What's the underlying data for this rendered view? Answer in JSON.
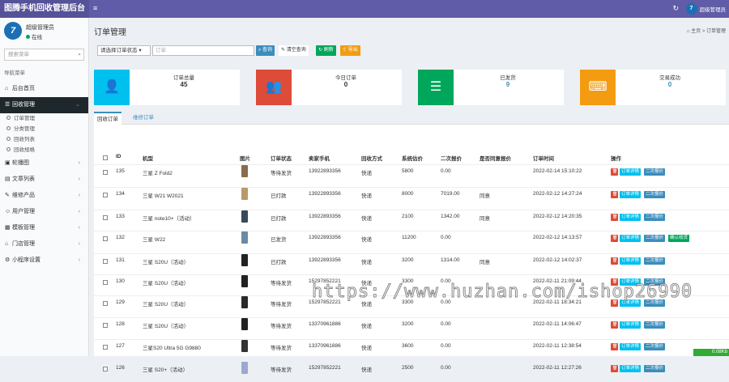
{
  "header": {
    "app_title": "图腾手机回收管理后台",
    "menu_icon": "≡",
    "refresh_icon": "↻",
    "user_name": "超级管理员",
    "avatar_glyph": "7"
  },
  "sidebar": {
    "user_name": "超级管理员",
    "status": "在线",
    "search_placeholder": "搜索菜单",
    "nav_header": "导航菜单",
    "items": [
      {
        "label": "后台首页",
        "icon": "home-icon",
        "active": false,
        "top": true
      },
      {
        "label": "回收管理",
        "icon": "list-icon",
        "active": true
      },
      {
        "label": "轮播图",
        "icon": "image-icon"
      },
      {
        "label": "文章列表",
        "icon": "doc-icon"
      },
      {
        "label": "维修产品",
        "icon": "wrench-icon"
      },
      {
        "label": "用户管理",
        "icon": "user-icon"
      },
      {
        "label": "模板管理",
        "icon": "template-icon"
      },
      {
        "label": "门店管理",
        "icon": "store-icon"
      },
      {
        "label": "小程序设置",
        "icon": "settings-icon"
      }
    ],
    "subitems": [
      "订单管理",
      "分类管理",
      "回收列表",
      "回收规格"
    ]
  },
  "page": {
    "title": "订单管理",
    "breadcrumb_home": "主页",
    "breadcrumb_current": "订单管理"
  },
  "filter": {
    "status_select": "请选择订单状态",
    "search_placeholder": "订单",
    "btn_search": "查询",
    "btn_clear": "清空查询",
    "btn_refresh": "刷新",
    "btn_export": "导出"
  },
  "stats": [
    {
      "label": "订单总量",
      "value": "45",
      "color": "#00c0ef",
      "icon": "user-icon"
    },
    {
      "label": "今日订单",
      "value": "0",
      "color": "#dd4b39",
      "icon": "users-icon"
    },
    {
      "label": "已发货",
      "value": "9",
      "color": "#00a65a",
      "icon": "list-icon"
    },
    {
      "label": "交易成功",
      "value": "0",
      "color": "#f39c12",
      "icon": "keyboard-icon"
    }
  ],
  "tabs": [
    "回收订单",
    "维修订单"
  ],
  "table": {
    "headers": [
      "ID",
      "机型",
      "图片",
      "订单状态",
      "卖家手机",
      "回收方式",
      "系统估价",
      "二次报价",
      "是否同意报价",
      "订单时间",
      "操作"
    ],
    "actions": {
      "detail": "订单详情",
      "quote": "二次报价",
      "confirm": "确认收货"
    },
    "rows": [
      {
        "id": "135",
        "model": "三星 Z Fold2",
        "status": "等待发货",
        "phone": "13922893356",
        "method": "快递",
        "est": "5800",
        "quote": "0.00",
        "agree": "",
        "time": "2022-02-14 15:10:22",
        "thumb": "#8a6b4e",
        "confirm": false
      },
      {
        "id": "134",
        "model": "三星 W21 W2021",
        "status": "已打款",
        "phone": "13922893356",
        "method": "快递",
        "est": "8000",
        "quote": "7019.00",
        "agree": "同意",
        "time": "2022-02-12 14:27:24",
        "thumb": "#b89a6a",
        "confirm": false
      },
      {
        "id": "133",
        "model": "三星 note10+（活动）",
        "status": "已打款",
        "phone": "13922893356",
        "method": "快递",
        "est": "2100",
        "quote": "1342.00",
        "agree": "同意",
        "time": "2022-02-12 14:20:35",
        "thumb": "#3a4a5a",
        "confirm": false
      },
      {
        "id": "132",
        "model": "三星 W22",
        "status": "已发货",
        "phone": "13922893356",
        "method": "快递",
        "est": "11200",
        "quote": "0.00",
        "agree": "",
        "time": "2022-02-12 14:13:57",
        "thumb": "#6a8aa6",
        "confirm": true
      },
      {
        "id": "131",
        "model": "三星 S20U（活动）",
        "status": "已打款",
        "phone": "13922893356",
        "method": "快递",
        "est": "3200",
        "quote": "1314.00",
        "agree": "同意",
        "time": "2022-02-12 14:02:37",
        "thumb": "#222",
        "confirm": false
      },
      {
        "id": "130",
        "model": "三星 S20U（活动）",
        "status": "等待发货",
        "phone": "15297852221",
        "method": "快递",
        "est": "3300",
        "quote": "0.00",
        "agree": "",
        "time": "2022-02-11 21:09:44",
        "thumb": "#222",
        "confirm": false
      },
      {
        "id": "129",
        "model": "三星 S20U（活动）",
        "status": "等待发货",
        "phone": "15297852221",
        "method": "快递",
        "est": "3300",
        "quote": "0.00",
        "agree": "",
        "time": "2022-02-11 18:34:21",
        "thumb": "#2a2a2a",
        "confirm": false
      },
      {
        "id": "128",
        "model": "三星 S20U（活动）",
        "status": "等待发货",
        "phone": "13370961886",
        "method": "快递",
        "est": "3200",
        "quote": "0.00",
        "agree": "",
        "time": "2022-02-11 14:06:47",
        "thumb": "#222",
        "confirm": false
      },
      {
        "id": "127",
        "model": "三星S20 Ultra 5G  G9880",
        "status": "等待发货",
        "phone": "13370961886",
        "method": "快递",
        "est": "3600",
        "quote": "0.00",
        "agree": "",
        "time": "2022-02-11 12:38:54",
        "thumb": "#333",
        "confirm": false
      },
      {
        "id": "126",
        "model": "三星 S20+（活动）",
        "status": "等待发货",
        "phone": "15297852221",
        "method": "快递",
        "est": "2500",
        "quote": "0.00",
        "agree": "",
        "time": "2022-02-11 12:27:26",
        "thumb": "#9ac",
        "confirm": false
      }
    ]
  },
  "watermark": "https://www.huzhan.com/ishop26990",
  "speed_badge": "0.08Kb"
}
